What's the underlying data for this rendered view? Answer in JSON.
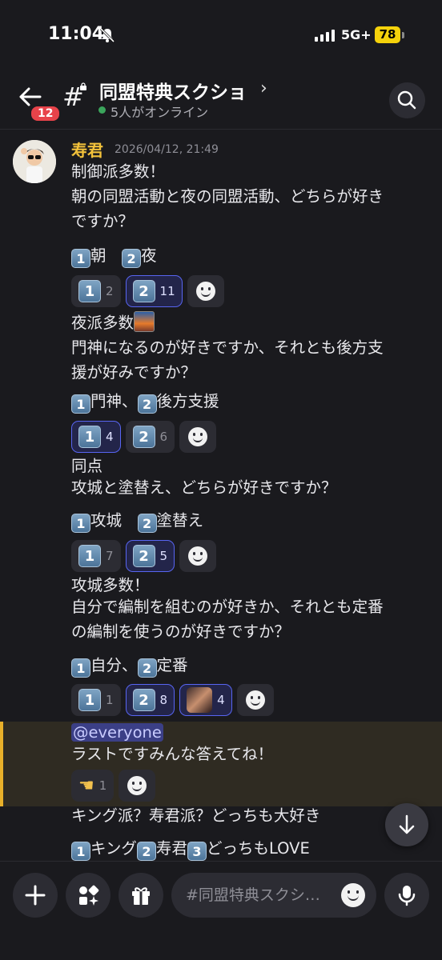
{
  "status_bar": {
    "time": "11:04",
    "network": "5G+",
    "battery": "78"
  },
  "header": {
    "unread_count": "12",
    "channel_name": "同盟特典スクショ",
    "chevron": "›",
    "online_text": "5人がオンライン"
  },
  "message": {
    "author": "寿君",
    "timestamp": "2026/04/12, 21:49",
    "blocks": [
      {
        "lines": [
          "制御派多数！",
          "朝の同盟活動と夜の同盟活動、どちらが好き",
          "ですか？"
        ],
        "options": {
          "o1": "朝",
          "o2": "夜"
        },
        "reactions": [
          {
            "emoji": "1",
            "count": "2"
          },
          {
            "emoji": "2",
            "count": "11"
          }
        ]
      },
      {
        "lines": [
          "夜派多数",
          "門神になるのが好きですか、それとも後方支",
          "援が好みですか？"
        ],
        "options": {
          "o1": "門神、",
          "o2": "後方支援"
        },
        "reactions": [
          {
            "emoji": "1",
            "count": "4"
          },
          {
            "emoji": "2",
            "count": "6"
          }
        ]
      },
      {
        "lines": [
          "同点",
          "攻城と塗替え、どちらが好きですか？"
        ],
        "options": {
          "o1": "攻城",
          "o2": "塗替え"
        },
        "reactions": [
          {
            "emoji": "1",
            "count": "7"
          },
          {
            "emoji": "2",
            "count": "5"
          }
        ]
      },
      {
        "lines": [
          "攻城多数！",
          "自分で編制を組むのが好きか、それとも定番",
          "の編制を使うのが好きですか？"
        ],
        "options": {
          "o1": "自分、",
          "o2": "定番"
        },
        "reactions": [
          {
            "emoji": "1",
            "count": "1"
          },
          {
            "emoji": "2",
            "count": "8"
          },
          {
            "emoji": "custom",
            "count": "4"
          }
        ]
      },
      {
        "mention": "@everyone",
        "lines": [
          "ラストですみんな答えてね！"
        ],
        "reactions": [
          {
            "emoji": "point-left-hand",
            "count": "1"
          }
        ]
      },
      {
        "lines": [
          "キング派？寿君派？どっちも大好き"
        ],
        "options": {
          "o1": "キング",
          "o2": "寿君",
          "o3": "どっちもLOVE"
        }
      }
    ]
  },
  "composer": {
    "placeholder": "#同盟特典スクシ…"
  },
  "colors": {
    "accent": "#5865f2",
    "author": "#f3c23b",
    "highlight_bar": "#e8b02a",
    "badge": "#e8434a"
  }
}
